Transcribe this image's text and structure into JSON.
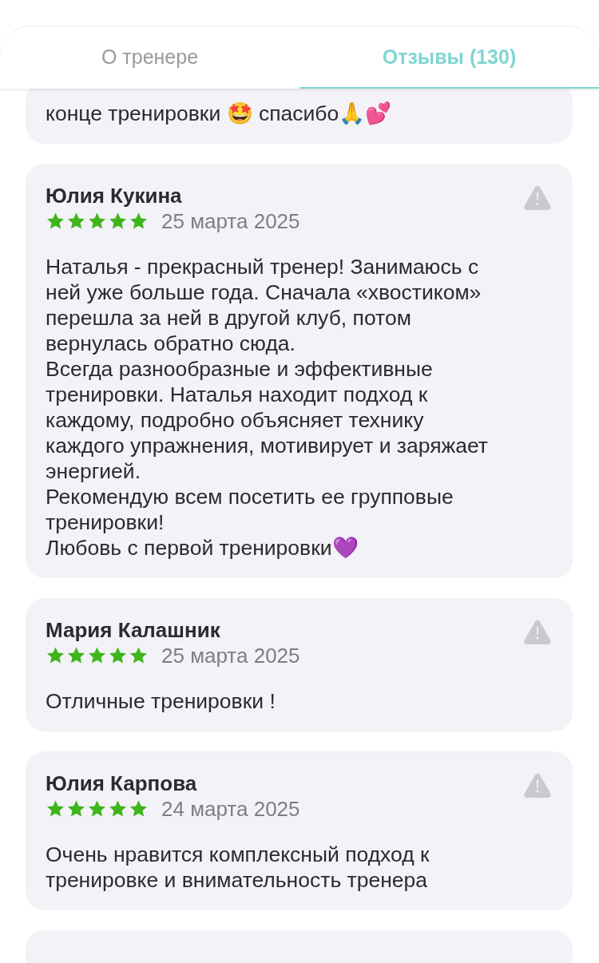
{
  "tabs": [
    {
      "label": "О тренере",
      "selected": false
    },
    {
      "label": "Отзывы (130)",
      "selected": true
    }
  ],
  "reviews": [
    {
      "text": "конце тренировки 🤩 спасибо🙏💕"
    },
    {
      "author": "Юлия Кукина",
      "stars": 5,
      "date": "25 марта 2025",
      "text": "Наталья - прекрасный тренер! Занимаюсь с\nней уже больше года. Сначала «хвостиком»\nперешла за ней в другой клуб, потом\nвернулась обратно сюда.\nВсегда разнообразные и эффективные\nтренировки. Наталья находит подход к\nкаждому, подробно объясняет технику\nкаждого упражнения, мотивирует и заряжает\nэнергией.\nРекомендую всем посетить ее групповые\nтренировки!\nЛюбовь с первой тренировки💜"
    },
    {
      "author": "Мария Калашник",
      "stars": 5,
      "date": "25 марта 2025",
      "text": "Отличные тренировки !"
    },
    {
      "author": "Юлия Карпова",
      "stars": 5,
      "date": "24 марта 2025",
      "text": "Очень нравится комплексный подход к\nтренировке и внимательность тренера"
    },
    {
      "kind": "peek"
    }
  ]
}
